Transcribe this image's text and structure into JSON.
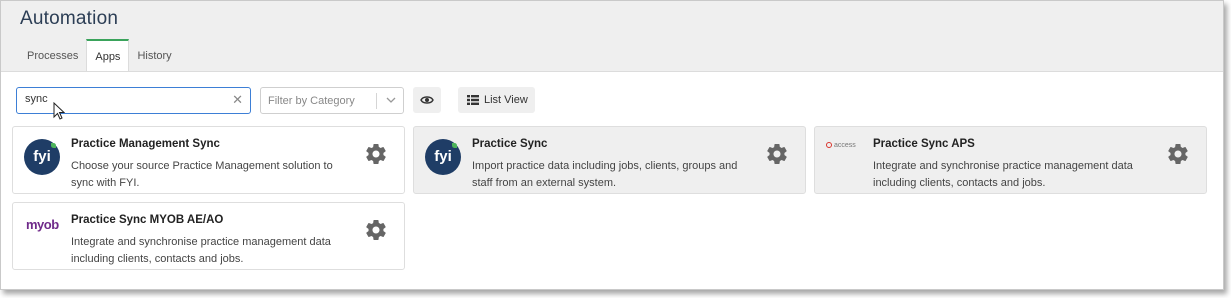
{
  "header": {
    "title": "Automation",
    "tabs": [
      {
        "label": "Processes",
        "active": false
      },
      {
        "label": "Apps",
        "active": true
      },
      {
        "label": "History",
        "active": false
      }
    ]
  },
  "toolbar": {
    "search_value": "sync",
    "filter_placeholder": "Filter by Category",
    "list_view_label": "List View"
  },
  "apps": [
    {
      "title": "Practice Management Sync",
      "description": "Choose your source Practice Management solution to sync with FYI.",
      "logo": "fyi",
      "logo_text": "fyi"
    },
    {
      "title": "Practice Sync",
      "description": "Import practice data including jobs, clients, groups and staff from an external system.",
      "logo": "fyi",
      "logo_text": "fyi"
    },
    {
      "title": "Practice Sync APS",
      "description": "Integrate and synchronise practice management data including clients, contacts and jobs.",
      "logo": "access",
      "logo_text": "access"
    },
    {
      "title": "Practice Sync MYOB AE/AO",
      "description": "Integrate and synchronise practice management data including clients, contacts and jobs.",
      "logo": "myob",
      "logo_text": "myob"
    }
  ],
  "colors": {
    "accent_tab": "#3aa35b",
    "search_border": "#3d7fd6",
    "fyi_navy": "#1f3d66",
    "myob_purple": "#6f2a8a"
  }
}
